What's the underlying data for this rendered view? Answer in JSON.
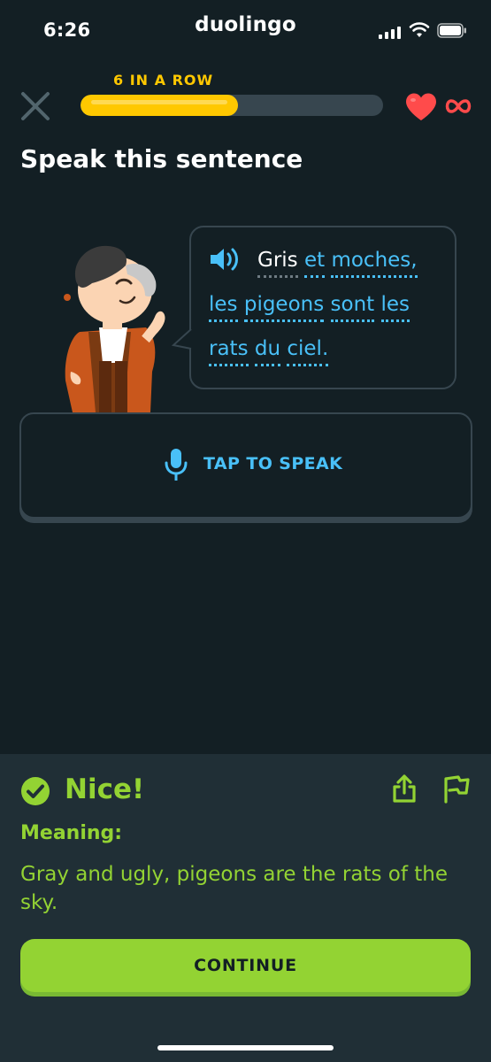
{
  "status_bar": {
    "time": "6:26",
    "app_name": "duolingo"
  },
  "lesson": {
    "streak_label": "6 IN A ROW",
    "progress": 0.52,
    "hearts": "∞",
    "title": "Speak this sentence"
  },
  "sentence": {
    "lines": [
      [
        "Gris",
        "et",
        "moches,"
      ],
      [
        "les",
        "pigeons",
        "sont",
        "les"
      ],
      [
        "rats",
        "du",
        "ciel."
      ]
    ]
  },
  "speak_button": {
    "label": "TAP TO SPEAK"
  },
  "feedback": {
    "status": "Nice!",
    "meaning_label": "Meaning:",
    "meaning_text": "Gray and ugly, pigeons are the rats of the sky.",
    "continue_label": "CONTINUE"
  },
  "colors": {
    "background": "#131f24",
    "accent_blue": "#49c0f8",
    "success_green": "#93d333",
    "streak_yellow": "#ffc800",
    "heart_red": "#ff4b4b"
  },
  "icons": [
    "close-icon",
    "heart-icon",
    "infinity-icon",
    "speaker-icon",
    "microphone-icon",
    "check-circle-icon",
    "share-icon",
    "flag-icon"
  ]
}
